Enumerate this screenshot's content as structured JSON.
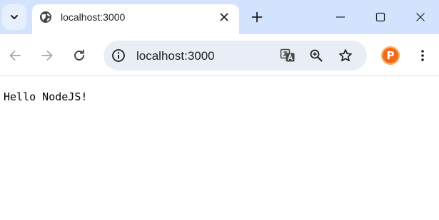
{
  "tab": {
    "title": "localhost:3000"
  },
  "address_bar": {
    "url": "localhost:3000"
  },
  "profile": {
    "initial": "P"
  },
  "page": {
    "text": "Hello NodeJS!"
  },
  "colors": {
    "tabstrip_bg": "#d3e3fd",
    "omnibox_bg": "#e9eef6",
    "profile_bg": "#ef6c1a"
  }
}
